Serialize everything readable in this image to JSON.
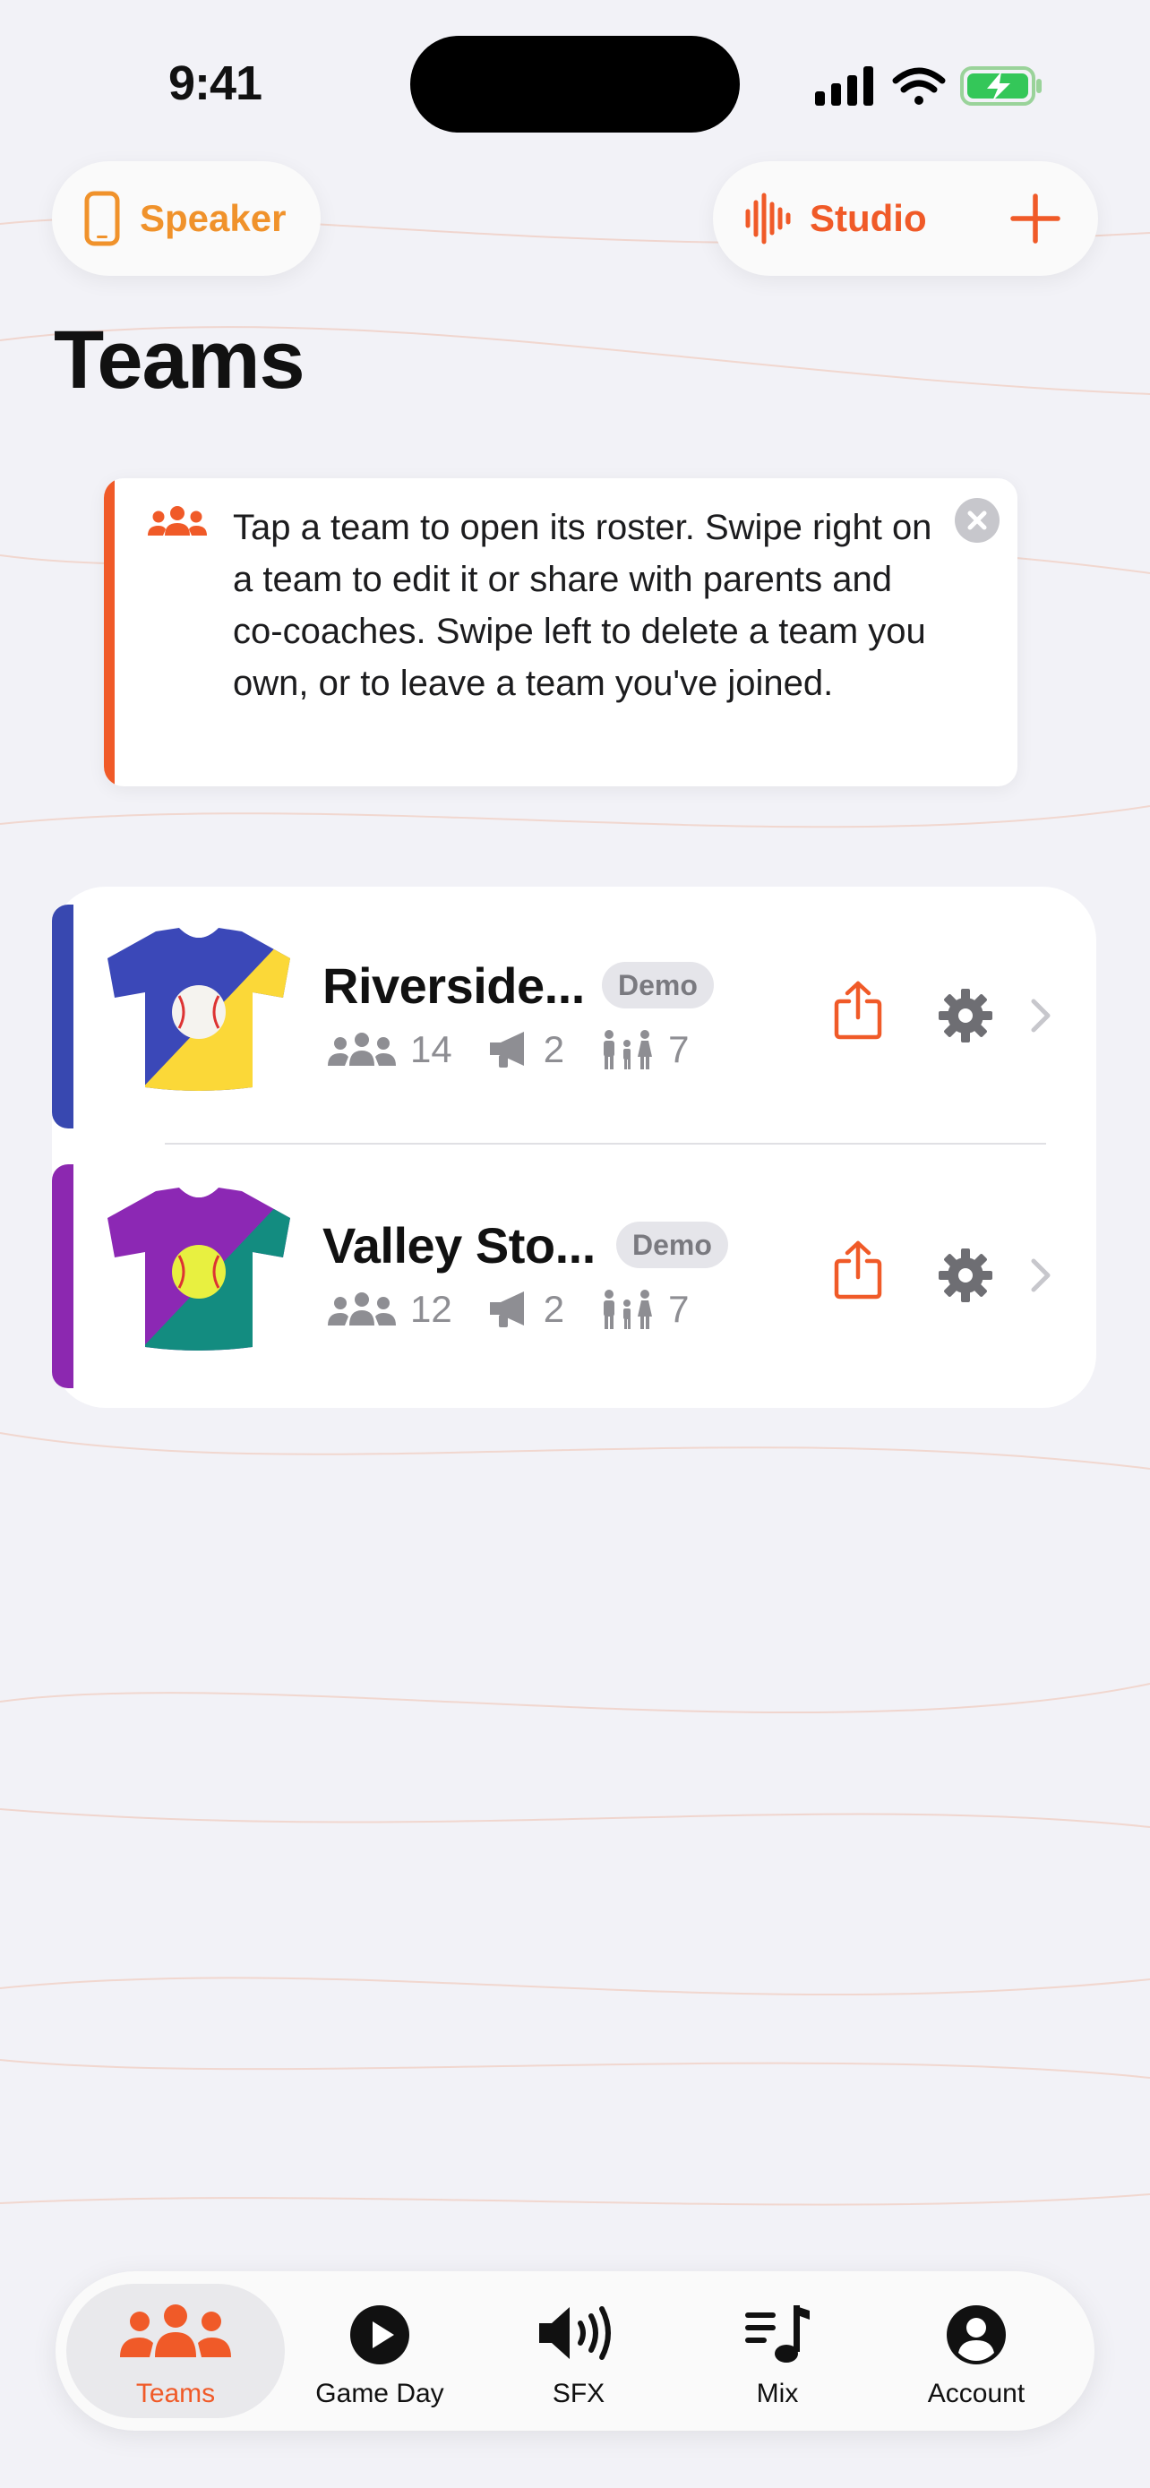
{
  "status": {
    "time": "9:41"
  },
  "top_bar": {
    "speaker_label": "Speaker",
    "studio_label": "Studio"
  },
  "page_title": "Teams",
  "tip": {
    "text": "Tap a team to open its roster. Swipe right on a team to edit it or share with parents and co-coaches. Swipe left to delete a team you own, or to leave a team you've joined."
  },
  "teams": [
    {
      "name": "Riverside...",
      "badge": "Demo",
      "players": "14",
      "announcers": "2",
      "families": "7",
      "stripe_color": "#3848b0",
      "jersey_top": "#3b48b8",
      "jersey_bottom": "#fbd838",
      "ball": "baseball"
    },
    {
      "name": "Valley Sto...",
      "badge": "Demo",
      "players": "12",
      "announcers": "2",
      "families": "7",
      "stripe_color": "#8c28b0",
      "jersey_top": "#8c28b4",
      "jersey_bottom": "#138c80",
      "ball": "softball"
    }
  ],
  "tabs": [
    {
      "label": "Teams",
      "icon": "people-icon",
      "active": true
    },
    {
      "label": "Game Day",
      "icon": "play-icon",
      "active": false
    },
    {
      "label": "SFX",
      "icon": "speaker-icon",
      "active": false
    },
    {
      "label": "Mix",
      "icon": "music-list-icon",
      "active": false
    },
    {
      "label": "Account",
      "icon": "person-circle-icon",
      "active": false
    }
  ],
  "colors": {
    "accent": "#f05a28",
    "speaker": "#f0922b",
    "background": "#f2f2f7"
  }
}
